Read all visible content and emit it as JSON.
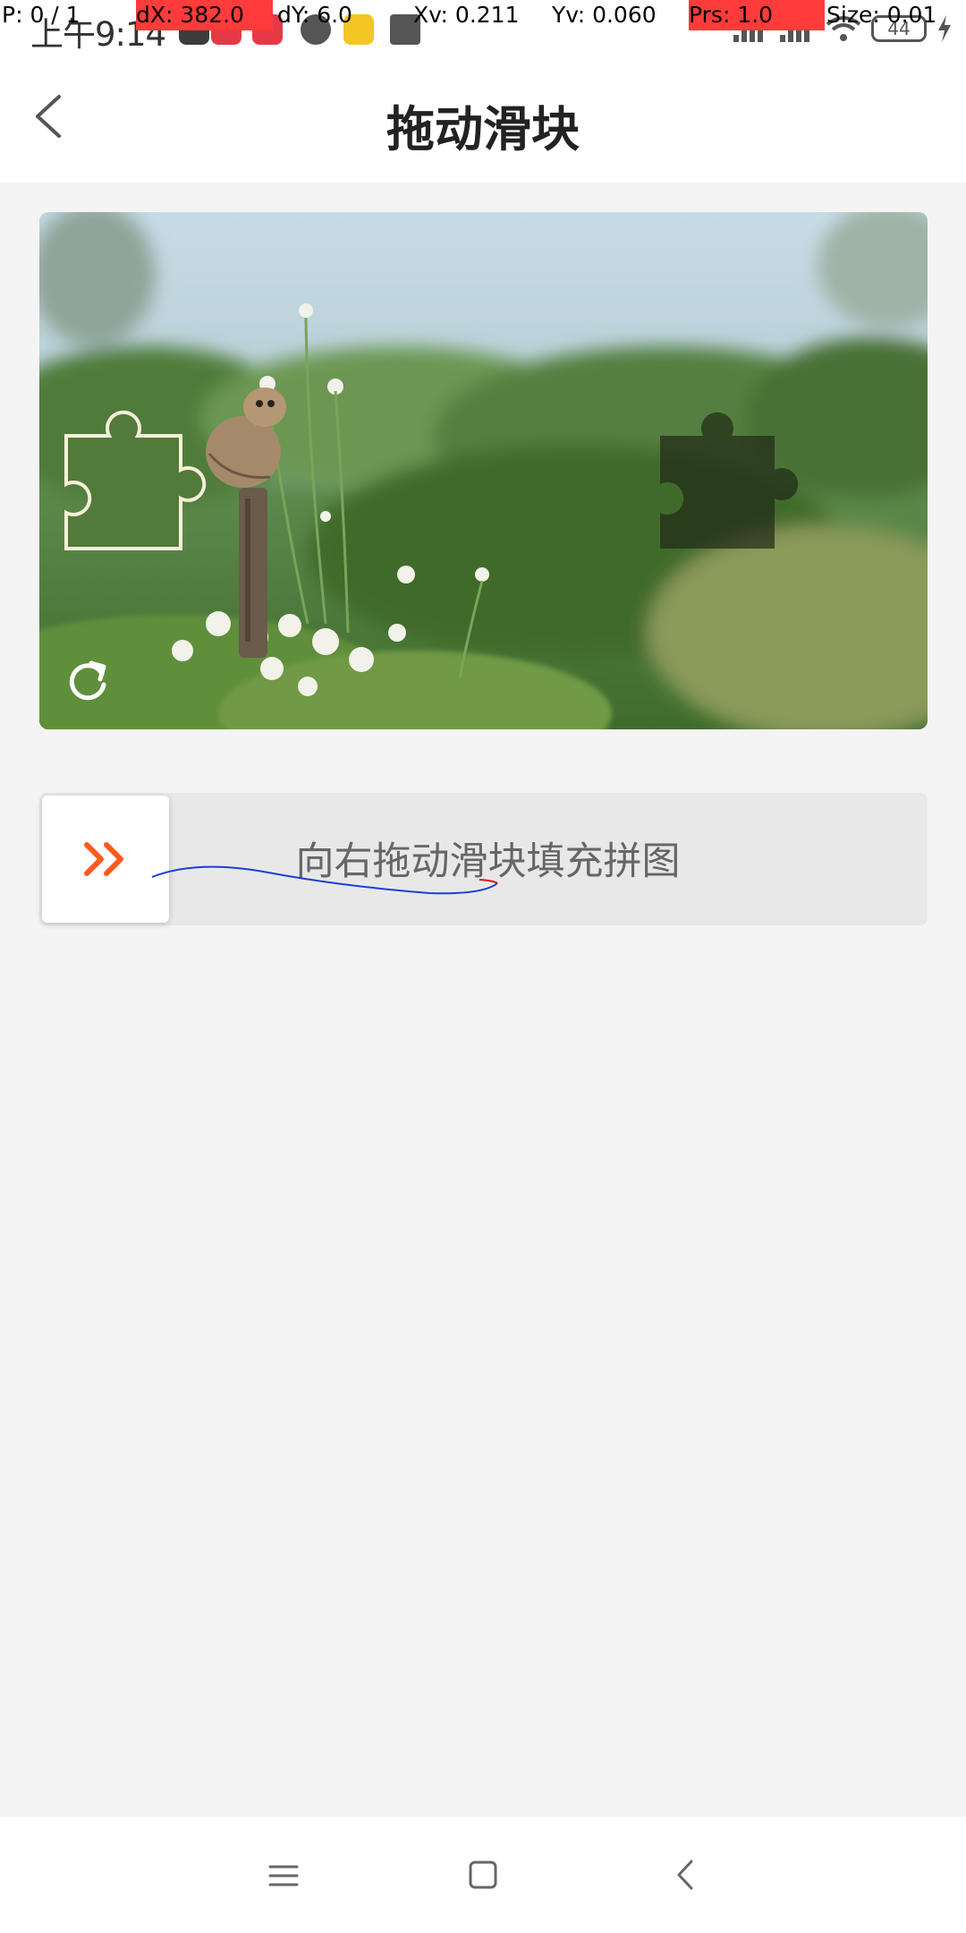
{
  "status_bar": {
    "time": "上午9:14",
    "battery_level": "44"
  },
  "debug_overlay": {
    "pointer": "P: 0 / 1",
    "dx": "dX: 382.0",
    "dy": "dY: 6.0",
    "xv": "Xv: 0.211",
    "yv": "Yv: 0.060",
    "prs": "Prs: 1.0",
    "size": "Size: 0.01"
  },
  "header": {
    "title": "拖动滑块"
  },
  "slider": {
    "hint": "向右拖动滑块填充拼图"
  },
  "icons": {
    "back": "back-icon",
    "refresh": "refresh-icon",
    "handle": "double-chevron-right-icon",
    "menu": "menu-icon",
    "home": "home-icon",
    "nav_back": "nav-back-icon"
  },
  "colors": {
    "accent": "#ff5a1f",
    "page_background": "#f4f4f4",
    "track": "#e8e8e8"
  }
}
